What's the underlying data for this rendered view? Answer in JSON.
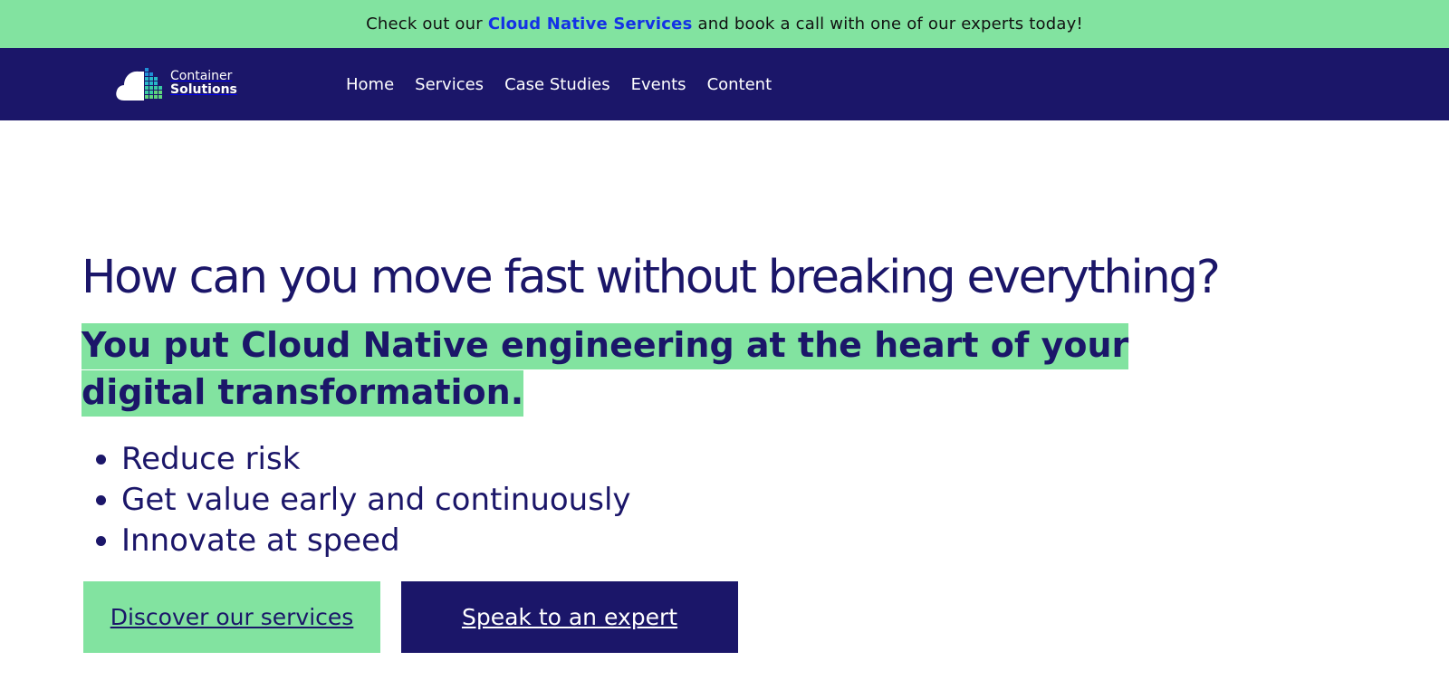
{
  "announcement": {
    "prefix": "Check out our",
    "link_label": "Cloud Native Services",
    "suffix": "and book a call with one of our experts today!"
  },
  "header": {
    "logo": {
      "line1": "Container",
      "line2": "Solutions"
    },
    "nav": [
      {
        "label": "Home"
      },
      {
        "label": "Services"
      },
      {
        "label": "Case Studies"
      },
      {
        "label": "Events"
      },
      {
        "label": "Content"
      }
    ]
  },
  "hero": {
    "title": "How can you move fast without breaking everything?",
    "subtitle": "You put Cloud Native engineering at the heart of your digital transformation.",
    "benefits": [
      "Reduce risk",
      "Get value early and continuously",
      "Innovate at speed"
    ],
    "primary_cta": "Discover our services",
    "secondary_cta": "Speak to an expert"
  },
  "colors": {
    "navy": "#1b1669",
    "mint": "#82e3a0",
    "link_blue": "#1432e6"
  }
}
